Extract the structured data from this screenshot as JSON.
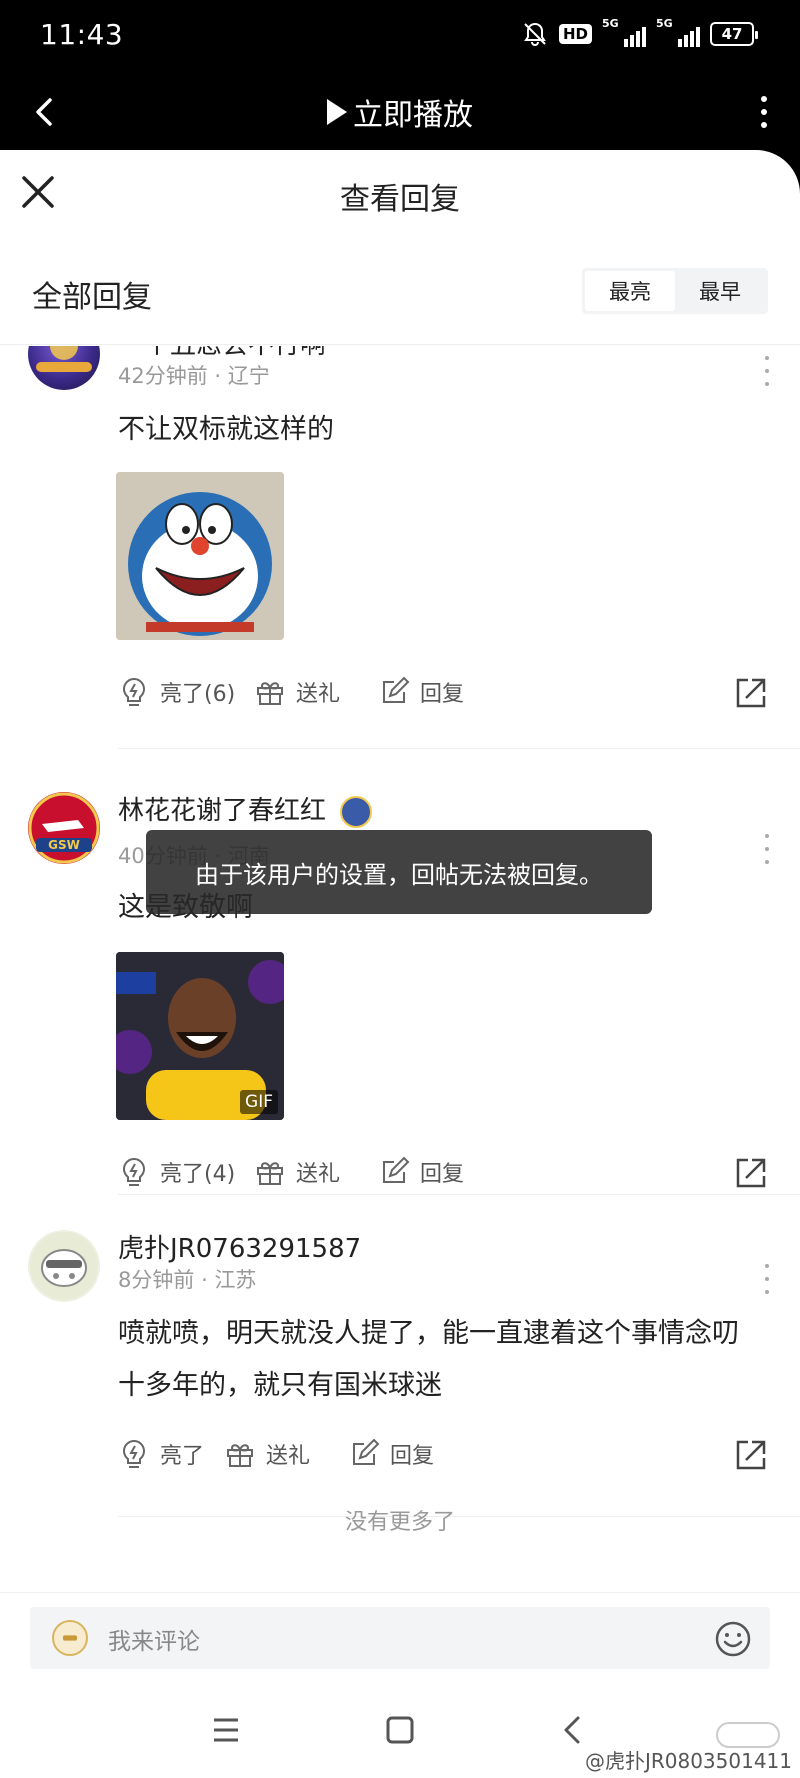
{
  "status_bar": {
    "time": "11:43",
    "hd": "HD",
    "net1": "5G",
    "net2": "5G",
    "battery": "47"
  },
  "nav": {
    "title": "立即播放"
  },
  "sheet": {
    "title": "查看回复",
    "filter_label": "全部回复",
    "sort_options": [
      "最亮",
      "最早"
    ],
    "active_sort": "最亮"
  },
  "comments": [
    {
      "username": "一个丑态会不行啊",
      "time": "42分钟前",
      "location": "辽宁",
      "text": "不让双标就这样的",
      "image": "doraemon-smirk",
      "actions": {
        "like": "亮了(6)",
        "gift": "送礼",
        "reply": "回复"
      }
    },
    {
      "username": "林花花谢了春红红",
      "time": "40分钟前",
      "location": "河南",
      "text": "这是致敬啊",
      "image": "laughing-player-gif",
      "gif_label": "GIF",
      "actions": {
        "like": "亮了(4)",
        "gift": "送礼",
        "reply": "回复"
      }
    },
    {
      "username": "虎扑JR0763291587",
      "time": "8分钟前",
      "location": "江苏",
      "text": "喷就喷，明天就没人提了，能一直逮着这个事情念叨十多年的，就只有国米球迷",
      "actions": {
        "like": "亮了",
        "gift": "送礼",
        "reply": "回复"
      }
    }
  ],
  "meta_sep": "·",
  "no_more": "没有更多了",
  "toast": "由于该用户的设置，回帖无法被回复。",
  "input": {
    "placeholder": "我来评论"
  },
  "watermark": "@虎扑JR0803501411",
  "colors": {
    "accent": "#222222",
    "muted": "#999999",
    "sheet_bg": "#ffffff"
  }
}
